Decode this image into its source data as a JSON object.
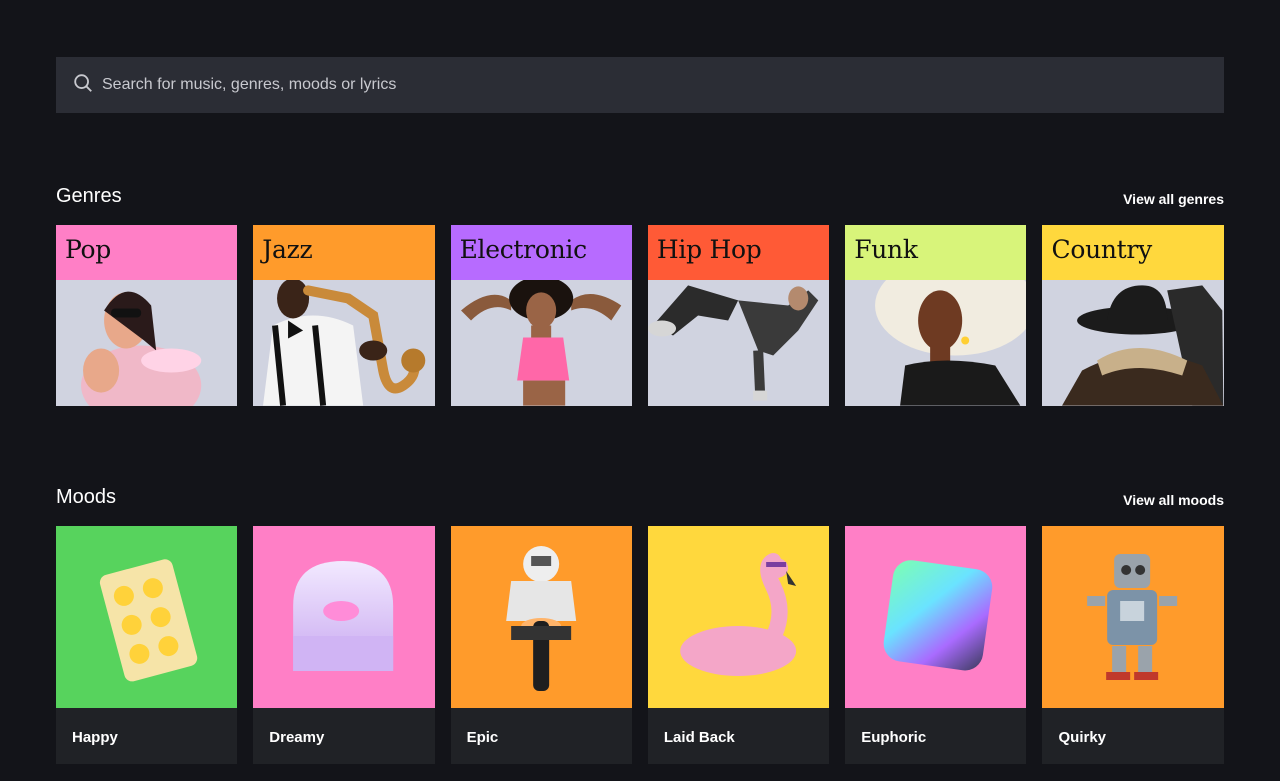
{
  "search": {
    "placeholder": "Search for music, genres, moods or lyrics"
  },
  "genres": {
    "title": "Genres",
    "view_all": "View all genres",
    "items": [
      {
        "label": "Pop",
        "color": "#ff7fc6"
      },
      {
        "label": "Jazz",
        "color": "#ff9b2b"
      },
      {
        "label": "Electronic",
        "color": "#b76bff"
      },
      {
        "label": "Hip Hop",
        "color": "#ff5a36"
      },
      {
        "label": "Funk",
        "color": "#d8f47a"
      },
      {
        "label": "Country",
        "color": "#ffd83d"
      }
    ]
  },
  "moods": {
    "title": "Moods",
    "view_all": "View all moods",
    "items": [
      {
        "label": "Happy",
        "color": "#57d35d"
      },
      {
        "label": "Dreamy",
        "color": "#ff7fc6"
      },
      {
        "label": "Epic",
        "color": "#ff9b2b"
      },
      {
        "label": "Laid Back",
        "color": "#ffd83d"
      },
      {
        "label": "Euphoric",
        "color": "#ff7fc6"
      },
      {
        "label": "Quirky",
        "color": "#ff9b2b"
      }
    ]
  }
}
